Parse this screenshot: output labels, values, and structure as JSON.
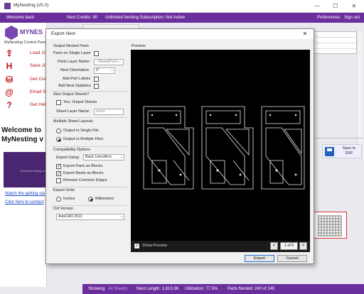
{
  "window": {
    "title": "MyNesting (v5.0)",
    "minimize": "—",
    "maximize": "☐",
    "close": "✕"
  },
  "topbar": {
    "welcome": "Welcome back",
    "nest_credits": "Nest Credits:  90",
    "subscription": "Unlimited Nesting Subscription:  Not Active",
    "preferences": "Preferences",
    "sign_out": "Sign out",
    "accent": "#6b2f9d"
  },
  "sidebar": {
    "logo_text": "MYNES",
    "control_panel": "MyNesting Control Panel",
    "items": [
      {
        "icon": "upload-icon",
        "label": "Load Job"
      },
      {
        "icon": "save-icon",
        "label": "Save Job"
      },
      {
        "icon": "credits-icon",
        "label": "Get Cred"
      },
      {
        "icon": "email-icon",
        "label": "Email S"
      },
      {
        "icon": "help-icon",
        "label": "Get Help"
      }
    ],
    "welcome_line1": "Welcome to",
    "welcome_line2": "MyNesting v",
    "video_text": "Powerful nesting software",
    "link_video": "Watch the getting sta",
    "link_contact": "Click here to contact"
  },
  "right_panel": {
    "save_dxf": "Save to DXF"
  },
  "status_bar": {
    "showing_label": "Showing:",
    "showing_value": "All Sheets",
    "nest_length": "Nest Length:  1,813.96",
    "utilization": "Utilization:  77.5%",
    "parts_nested": "Parts Nested:  240 of 240"
  },
  "dialog": {
    "title": "Export Nest",
    "close": "✕",
    "output_parts": {
      "group": "Output Nested Parts",
      "parts_single_layer": "Parts on Single Layer",
      "parts_single_layer_checked": false,
      "parts_layer_name_label": "Parts Layer Name:",
      "parts_layer_name_value": "--NestedParts--",
      "nest_orientation_label": "Nest Orientation:",
      "nest_orientation_value": "0°",
      "add_part_labels": "Add Part Labels",
      "add_part_labels_checked": false,
      "add_nest_statistics": "Add Nest Statistics",
      "add_nest_statistics_checked": false
    },
    "output_sheets": {
      "group": "Also Output Sheets?",
      "yes_output": "Yes, Output Sheets",
      "yes_output_checked": false,
      "sheet_layer_label": "Sheet Layer Name:",
      "sheet_layer_value": "sheet"
    },
    "multi_sheet": {
      "group": "Multiple Sheet Layouts",
      "single_file": "Output to Single File",
      "multiple_files": "Output to Multiple Files",
      "selected": "multiple"
    },
    "compatibility": {
      "group": "Compatibility Options",
      "export_using_label": "Export Using:",
      "export_using_value": "Basic Lines/Arcs",
      "export_parts_blocks": "Export Parts as Blocks",
      "export_parts_blocks_checked": true,
      "export_nests_blocks": "Export Nests as Blocks",
      "export_nests_blocks_checked": true,
      "remove_common_edges": "Remove Common Edges",
      "remove_common_edges_checked": false
    },
    "units": {
      "group": "Export Units",
      "inches": "Inches",
      "millimeters": "Millimeters",
      "selected": "millimeters"
    },
    "dxf": {
      "group": "Dxf Version",
      "value": "AutoCAD 2013"
    },
    "preview": {
      "label": "Preview",
      "show_preview": "Show Preview",
      "show_preview_checked": true,
      "prev": "<",
      "page": "1 of 5",
      "next": ">"
    },
    "export_button": "Export",
    "cancel_button": "Cancel"
  }
}
